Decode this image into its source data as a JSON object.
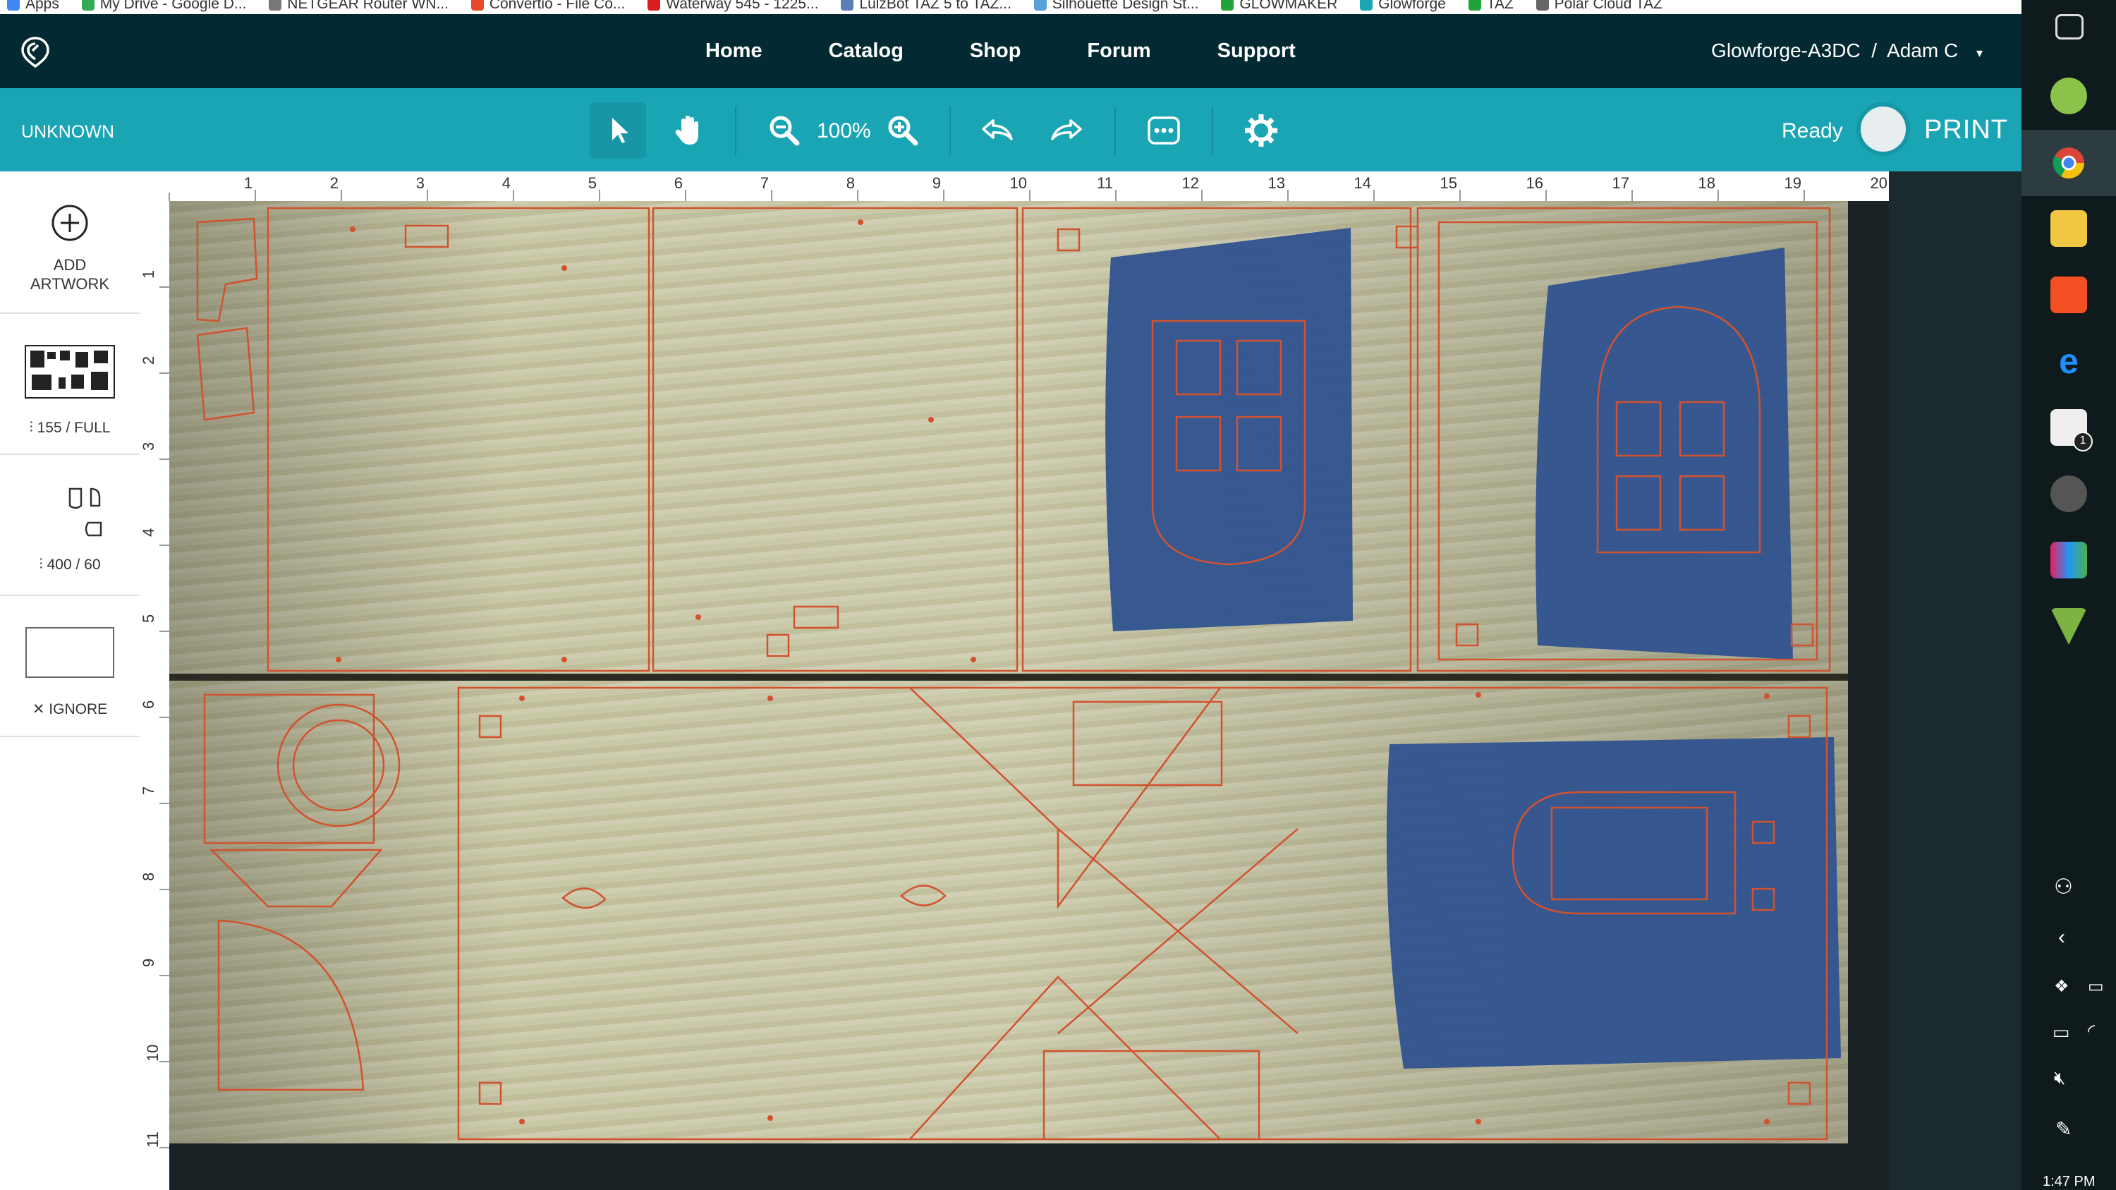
{
  "browser": {
    "bookmarks": [
      "Apps",
      "My Drive - Google D...",
      "NETGEAR Router WN...",
      "Convertio - File Co...",
      "Waterway 545 - 1225...",
      "LulzBot TAZ 5 to TAZ...",
      "Silhouette Design St...",
      "GLOWMAKER",
      "Glowforge",
      "TAZ",
      "Polar Cloud TAZ"
    ]
  },
  "nav": {
    "links": [
      "Home",
      "Catalog",
      "Shop",
      "Forum",
      "Support"
    ],
    "account": "Glowforge-A3DC  /  Adam C",
    "account_caret": "▾"
  },
  "toolbar": {
    "material": "UNKNOWN",
    "zoom": "100%",
    "status": "Ready",
    "print_label": "PRINT"
  },
  "sidebar": {
    "add_artwork_label": "ADD ARTWORK",
    "engrave_setting": "155 / FULL",
    "cut_setting": "400 / 60",
    "ignore_label": "IGNORE"
  },
  "ruler": {
    "top_ticks": [
      "1",
      "2",
      "3",
      "4",
      "5",
      "6",
      "7",
      "8",
      "9",
      "10",
      "11",
      "12",
      "13",
      "14",
      "15",
      "16",
      "17",
      "18",
      "19",
      "20"
    ],
    "left_ticks": [
      "1",
      "2",
      "3",
      "4",
      "5",
      "6",
      "7",
      "8",
      "9",
      "10",
      "11"
    ]
  },
  "taskbar": {
    "clock": "1:47 PM",
    "mail_badge": "1"
  },
  "colors": {
    "nav_bg": "#032a32",
    "toolbar_bg": "#1aa5b5",
    "cut_line": "#d2522e",
    "tape": "#30528f"
  }
}
